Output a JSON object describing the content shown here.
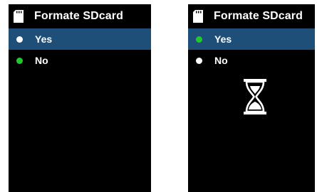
{
  "screens": [
    {
      "title": "Formate SDcard",
      "items": [
        {
          "label": "Yes",
          "selected": true,
          "indicator": "white"
        },
        {
          "label": "No",
          "selected": false,
          "indicator": "green"
        }
      ],
      "icon": "sd-card-icon"
    },
    {
      "title": "Formate SDcard",
      "items": [
        {
          "label": "Yes",
          "selected": true,
          "indicator": "green"
        },
        {
          "label": "No",
          "selected": false,
          "indicator": "white"
        }
      ],
      "icon": "sd-card-icon",
      "busy_icon": "hourglass-icon"
    }
  ],
  "colors": {
    "screen_background": "#000000",
    "selection_highlight": "#1e4f78",
    "text": "#ffffff",
    "active_indicator": "#21c82c",
    "inactive_indicator": "#ffffff"
  }
}
